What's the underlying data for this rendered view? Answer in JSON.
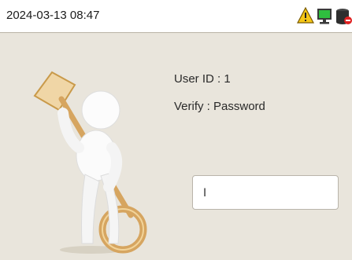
{
  "status_bar": {
    "datetime": "2024-03-13 08:47",
    "icons": [
      "warning-icon",
      "network-monitor-icon",
      "database-icon"
    ]
  },
  "verify_panel": {
    "user_id_text": "User ID : 1",
    "verify_mode_text": "Verify : Password",
    "password_input": {
      "value": "I"
    },
    "illustration": "figure-holding-key"
  },
  "colors": {
    "background": "#e9e5dc",
    "status_bar": "#ffffff",
    "key_gold": "#d6a560"
  }
}
